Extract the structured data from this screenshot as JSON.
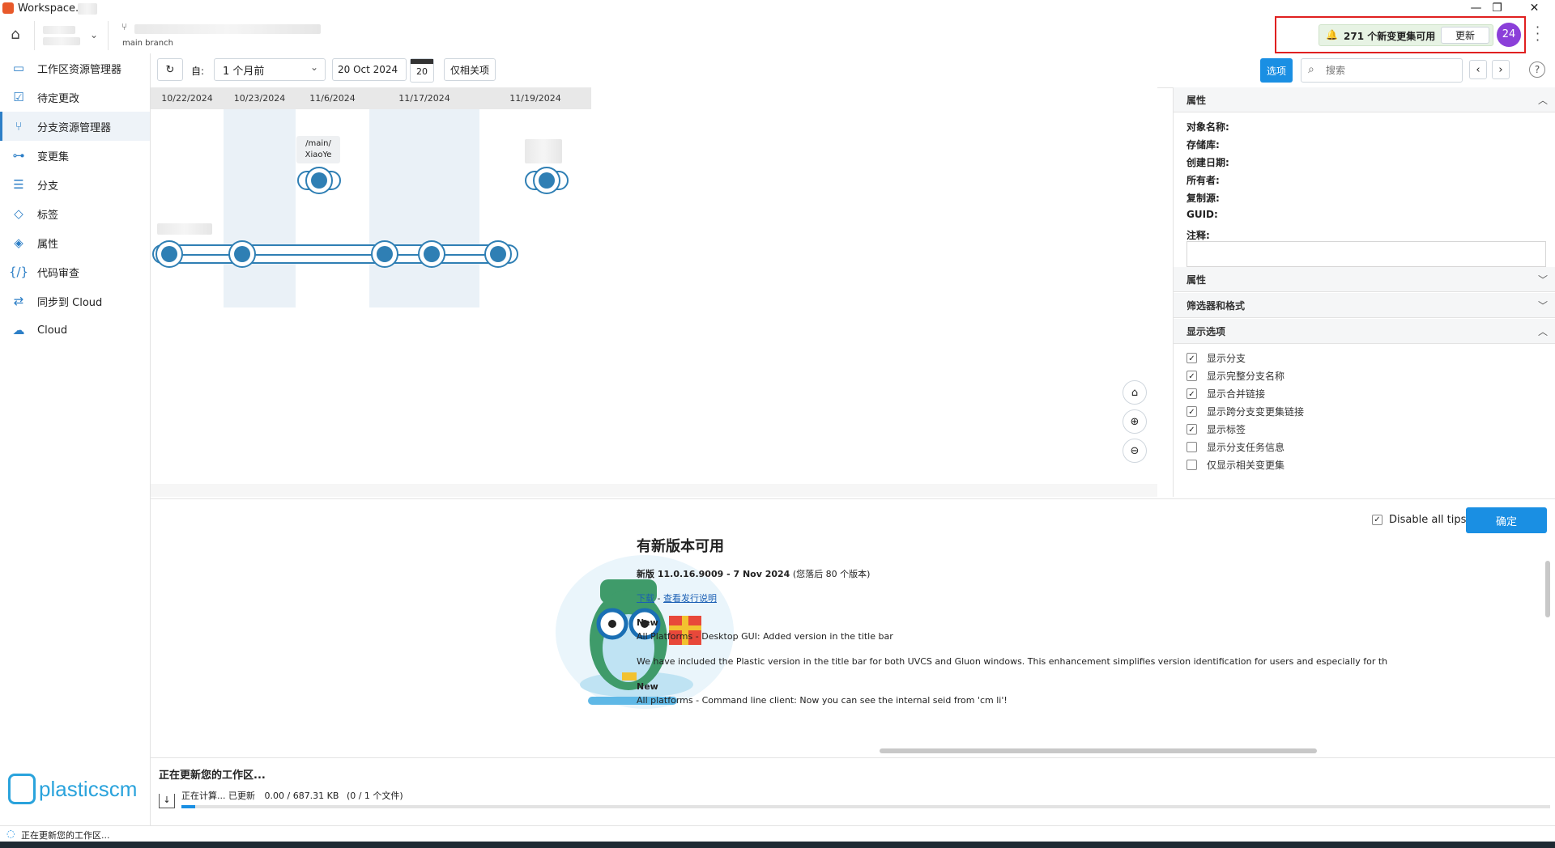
{
  "window": {
    "title": "Workspace."
  },
  "header": {
    "branch_label": "main branch",
    "notification": {
      "text": "271 个新变更集可用",
      "update_button": "更新"
    },
    "avatar_count": "24"
  },
  "sidebar": {
    "items": [
      {
        "label": "工作区资源管理器",
        "icon": "folder-icon"
      },
      {
        "label": "待定更改",
        "icon": "pending-changes-icon"
      },
      {
        "label": "分支资源管理器",
        "icon": "branch-explorer-icon"
      },
      {
        "label": "变更集",
        "icon": "changeset-icon"
      },
      {
        "label": "分支",
        "icon": "list-icon"
      },
      {
        "label": "标签",
        "icon": "tag-icon"
      },
      {
        "label": "属性",
        "icon": "attribute-icon"
      },
      {
        "label": "代码审查",
        "icon": "code-review-icon"
      },
      {
        "label": "同步到 Cloud",
        "icon": "sync-icon"
      },
      {
        "label": "Cloud",
        "icon": "cloud-icon"
      }
    ],
    "logo_text": "plasticscm"
  },
  "toolbar": {
    "from_label": "自:",
    "range_select": "1 个月前",
    "date_value": "20 Oct 2024",
    "calendar_day": "20",
    "related_only_button": "仅相关项",
    "options_button": "选项",
    "search_placeholder": "搜索"
  },
  "graph": {
    "dates": [
      "10/22/2024",
      "10/23/2024",
      "11/6/2024",
      "11/17/2024",
      "11/19/2024"
    ],
    "branch_label_line1": "/main/",
    "branch_label_line2": "XiaoYe"
  },
  "properties_panel": {
    "section1_title": "属性",
    "fields": [
      "对象名称:",
      "存储库:",
      "创建日期:",
      "所有者:",
      "复制源:",
      "GUID:",
      "注释:"
    ],
    "section2_title": "属性",
    "section3_title": "筛选器和格式",
    "section4_title": "显示选项",
    "display_options": [
      {
        "label": "显示分支",
        "checked": true
      },
      {
        "label": "显示完整分支名称",
        "checked": true
      },
      {
        "label": "显示合并链接",
        "checked": true
      },
      {
        "label": "显示跨分支变更集链接",
        "checked": true
      },
      {
        "label": "显示标签",
        "checked": true
      },
      {
        "label": "显示分支任务信息",
        "checked": false
      },
      {
        "label": "仅显示相关变更集",
        "checked": false
      }
    ]
  },
  "release": {
    "disable_tips_label": "Disable all tips",
    "ok_button": "确定",
    "title": "有新版本可用",
    "version_text": "新版 11.0.16.9009 - 7 Nov 2024",
    "behind_text": "(您落后 80 个版本)",
    "download_link": "下载",
    "separator": "-",
    "notes_link": "查看发行说明",
    "entries": [
      {
        "tag": "New",
        "title": "All Platforms - Desktop GUI: Added version in the title bar",
        "body": "We have included the Plastic version in the title bar for both UVCS and Gluon windows. This enhancement simplifies version identification for users and especially for th"
      },
      {
        "tag": "New",
        "title": "All platforms - Command line client: Now you can see the internal seid from 'cm li'!",
        "body": ""
      }
    ]
  },
  "progress": {
    "title": "正在更新您的工作区...",
    "status": "正在计算... 已更新",
    "size": "0.00 / 687.31 KB",
    "files": "(0 / 1 个文件)"
  },
  "statusbar": {
    "text": "正在更新您的工作区..."
  },
  "colors": {
    "accent": "#1a8fe3",
    "branch": "#2f7fb4",
    "highlight": "#e02020",
    "avatar": "#8b3fd9",
    "notify_bg": "#e7f3e4"
  }
}
